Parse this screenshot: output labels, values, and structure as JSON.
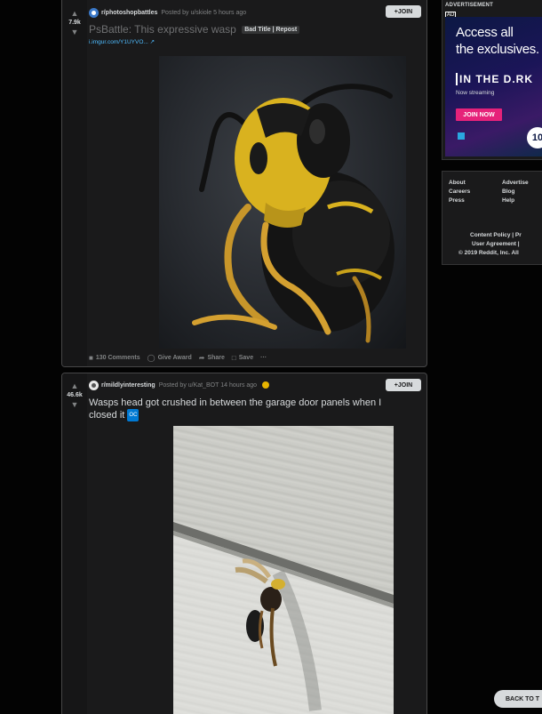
{
  "posts": [
    {
      "score": "7.9k",
      "subreddit": "r/photoshopbattles",
      "posted_by": "Posted by u/skiole 5 hours ago",
      "join_label": "+JOIN",
      "title": "PsBattle: This expressive wasp",
      "flair": "Bad Title | Repost",
      "link": "i.imgur.com/Y1UYVO...",
      "actions": {
        "comments": "130 Comments",
        "award": "Give Award",
        "share": "Share",
        "save": "Save",
        "more": "···"
      }
    },
    {
      "score": "46.6k",
      "subreddit": "r/mildlyinteresting",
      "posted_by": "Posted by u/Kat_BOT 14 hours ago",
      "join_label": "+JOIN",
      "title_line1": "Wasps head got crushed in between the garage door panels when I",
      "title_line2": "closed it",
      "flair": "OC"
    }
  ],
  "sidebar": {
    "ad": {
      "label": "ADVERTISEMENT",
      "badge": "AD",
      "headline1": "Access all",
      "headline2": "the exclusives.",
      "brand": "IN THE D.RK",
      "subtext": "Now streaming",
      "button": "JOIN NOW",
      "logo": "10"
    },
    "footer": {
      "col1": [
        "About",
        "Careers",
        "Press"
      ],
      "col2": [
        "Advertise",
        "Blog",
        "Help"
      ],
      "legal1": "Content Policy | Pr",
      "legal2": "User Agreement |",
      "legal3": "© 2019 Reddit, Inc. All"
    }
  },
  "back_to_top": "BACK TO T"
}
